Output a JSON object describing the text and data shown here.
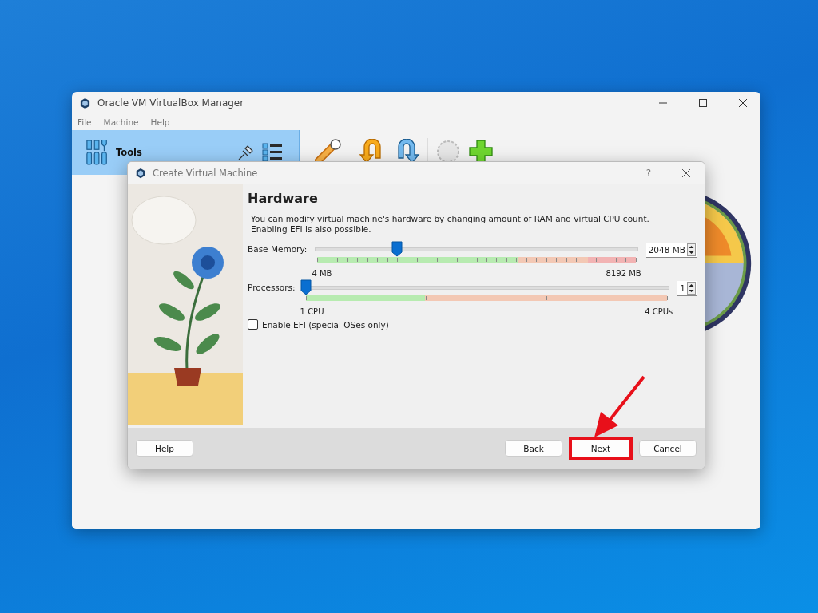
{
  "manager": {
    "title": "Oracle VM VirtualBox Manager",
    "menu": [
      "File",
      "Machine",
      "Help"
    ],
    "tools_label": "Tools"
  },
  "dialog": {
    "title": "Create Virtual Machine",
    "help_mark": "?",
    "heading": "Hardware",
    "description": "You can modify virtual machine's hardware by changing amount of RAM and virtual CPU count.\nEnabling EFI is also possible.",
    "sliders": [
      {
        "kind": "memory",
        "label": "Base Memory:",
        "level": 0.25,
        "min_label": "4 MB",
        "max_label": "8192 MB",
        "value": "2048 MB"
      },
      {
        "kind": "cpu",
        "label": "Processors:",
        "level": 0,
        "min_label": "1 CPU",
        "max_label": "4 CPUs",
        "value": "1"
      }
    ],
    "checkbox": {
      "label": "Enable EFI (special OSes only)",
      "checked": false
    },
    "buttons": [
      {
        "label": "Help",
        "highlighted": false
      },
      {
        "label": "Back",
        "highlighted": false
      },
      {
        "label": "Next",
        "highlighted": true
      },
      {
        "label": "Cancel",
        "highlighted": false
      }
    ]
  }
}
